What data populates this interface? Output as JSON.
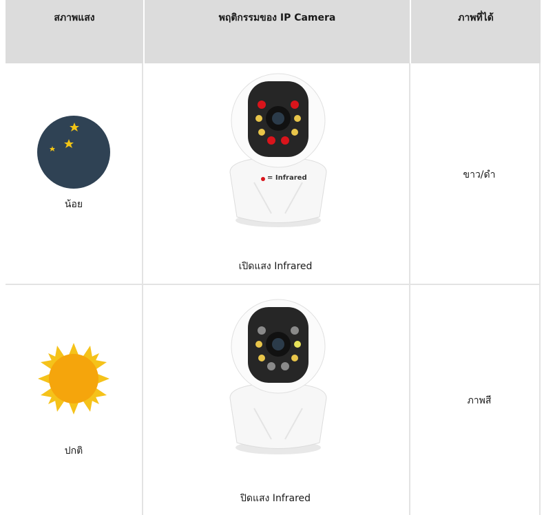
{
  "table": {
    "headers": [
      "สภาพแสง",
      "พฤติกรรมของ IP Camera",
      "ภาพที่ได้"
    ],
    "rows": [
      {
        "light_icon": "moon-stars-icon",
        "light": "น้อย",
        "behavior_label": "เปิดแสง Infrared",
        "camera_callout": "= Infrared",
        "result": "ขาว/ดำ"
      },
      {
        "light_icon": "sun-icon",
        "light": "ปกติ",
        "behavior_label": "ปิดแสง Infrared",
        "result": "ภาพสี"
      }
    ]
  },
  "colors": {
    "header_bg": "#dcdcdc",
    "grid": "#e3e3e3",
    "moon_bg": "#2f4254",
    "moon": "#f3c515",
    "sun": "#f5a50c",
    "infrared": "#d9141b"
  }
}
